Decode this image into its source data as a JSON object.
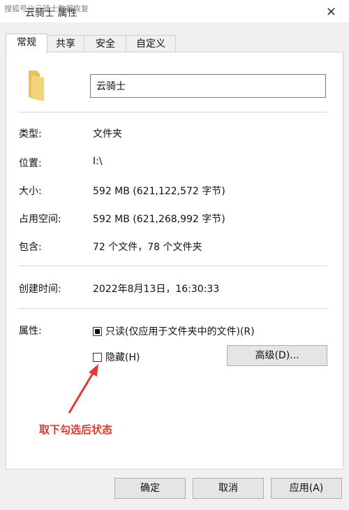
{
  "window": {
    "title": "云骑士 属性",
    "watermark": "搜狐号@云骑士数据恢复",
    "close_glyph": "×"
  },
  "tabs": [
    {
      "label": "常规",
      "active": true
    },
    {
      "label": "共享",
      "active": false
    },
    {
      "label": "安全",
      "active": false
    },
    {
      "label": "自定义",
      "active": false
    }
  ],
  "general": {
    "name_value": "云骑士",
    "type_label": "类型:",
    "type_value": "文件夹",
    "location_label": "位置:",
    "location_value": "I:\\",
    "size_label": "大小:",
    "size_value": "592 MB (621,122,572 字节)",
    "disk_label": "占用空间:",
    "disk_value": "592 MB (621,268,992 字节)",
    "contains_label": "包含:",
    "contains_value": "72 个文件，78 个文件夹",
    "created_label": "创建时间:",
    "created_value": "2022年8月13日，16:30:33",
    "attributes_label": "属性:",
    "readonly_label": "只读(仅应用于文件夹中的文件)(R)",
    "hidden_label": "隐藏(H)",
    "advanced_button": "高级(D)...",
    "readonly_checked": true,
    "hidden_checked": false
  },
  "annotation": {
    "text": "取下勾选后状态",
    "color": "#e23a2e"
  },
  "footer": {
    "ok": "确定",
    "cancel": "取消",
    "apply": "应用(A)"
  }
}
